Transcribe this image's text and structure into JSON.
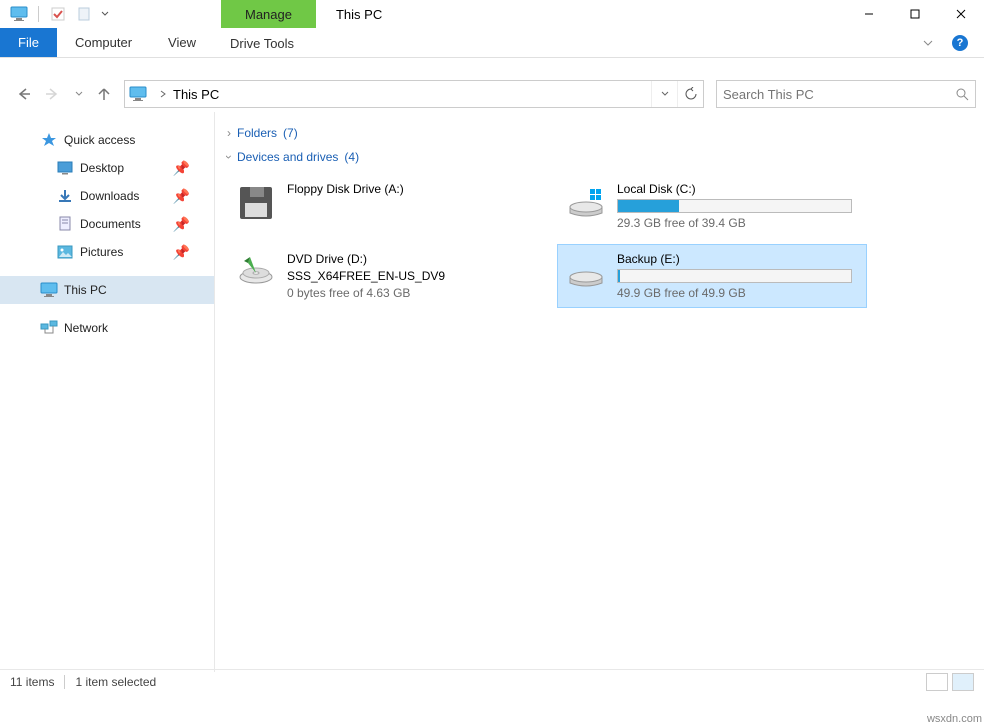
{
  "title": "This PC",
  "manage_tab": "Manage",
  "ribbon_tabs": {
    "file": "File",
    "computer": "Computer",
    "view": "View",
    "drive_tools": "Drive Tools"
  },
  "address": {
    "location": "This PC",
    "search_placeholder": "Search This PC"
  },
  "sidebar": {
    "quick_access": "Quick access",
    "quick_items": [
      {
        "label": "Desktop"
      },
      {
        "label": "Downloads"
      },
      {
        "label": "Documents"
      },
      {
        "label": "Pictures"
      }
    ],
    "this_pc": "This PC",
    "network": "Network"
  },
  "sections": {
    "folders": {
      "label": "Folders",
      "count": "7"
    },
    "drives": {
      "label": "Devices and drives",
      "count": "4"
    }
  },
  "drives": {
    "floppy": {
      "name": "Floppy Disk Drive (A:)"
    },
    "local": {
      "name": "Local Disk (C:)",
      "free": "29.3 GB free of 39.4 GB",
      "pct": 26
    },
    "dvd": {
      "name": "DVD Drive (D:)",
      "sub": "SSS_X64FREE_EN-US_DV9",
      "free": "0 bytes free of 4.63 GB"
    },
    "backup": {
      "name": "Backup (E:)",
      "free": "49.9 GB free of 49.9 GB",
      "pct": 1
    }
  },
  "status": {
    "items": "11 items",
    "selected": "1 item selected"
  },
  "watermark": "wsxdn.com"
}
